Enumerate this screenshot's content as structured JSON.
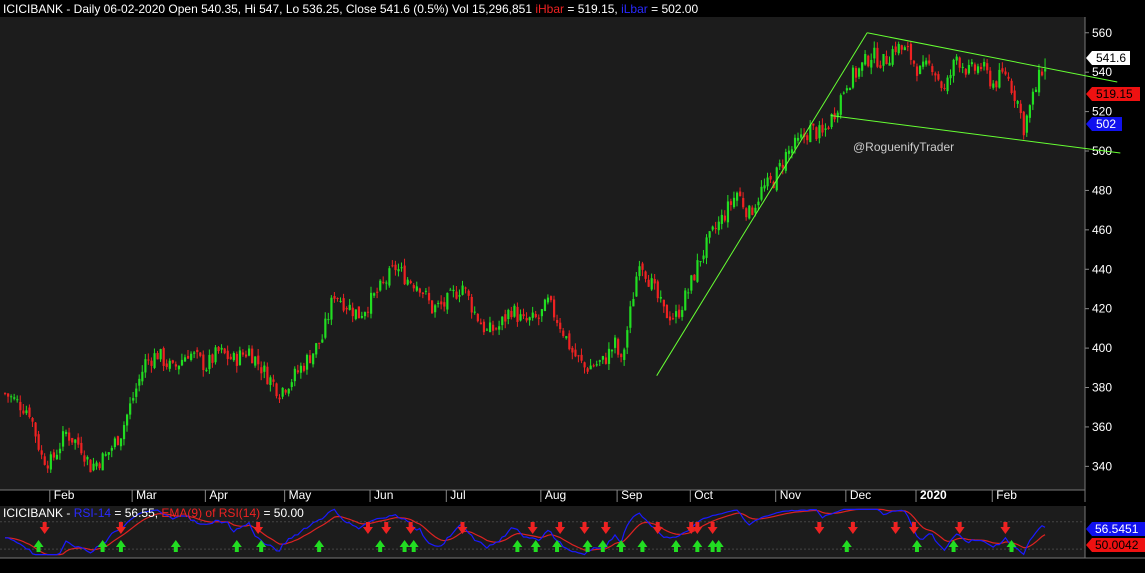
{
  "header": {
    "symbol": "ICICIBANK",
    "info": " - Daily 06-02-2020 Open 540.35, Hi 547, Lo 536.25, Close 541.6 (0.5%) Vol 15,296,851 ",
    "ihbar_label": "iHbar",
    "ihbar_value": " = 519.15, ",
    "ilbar_label": "iLbar",
    "ilbar_value": " = 502.00"
  },
  "watermark": "@RoguenifyTrader",
  "price_badges": {
    "close": "541.6",
    "ihbar": "519.15",
    "ilbar": "502"
  },
  "rsi_header": {
    "symbol": "ICICIBANK",
    "rsi_label": "RSI-14",
    "rsi_value": " = 56.55, ",
    "ema_label": "EMA(9) of RSI(14)",
    "ema_value": " = 50.00"
  },
  "rsi_badges": {
    "rsi": "56.5451",
    "ema": "50.0042"
  },
  "colors": {
    "background": "#000000",
    "plot_bg": "#1c1c1c",
    "up": "#22dd22",
    "down": "#ee2222",
    "channel": "#66ff33",
    "rsi": "#1a1aff",
    "ema": "#dd2222",
    "axis_text": "#ffffff",
    "badge_close": "#ffffff",
    "badge_ihbar": "#ee1111",
    "badge_ilbar": "#1111ee"
  },
  "chart_data": {
    "type": "candlestick",
    "y_ticks": [
      340,
      360,
      380,
      400,
      420,
      440,
      460,
      480,
      500,
      520,
      540,
      560
    ],
    "ylim": [
      328,
      568
    ],
    "x_labels": [
      "Feb",
      "Mar",
      "Apr",
      "May",
      "Jun",
      "Jul",
      "Aug",
      "Sep",
      "Oct",
      "Nov",
      "Dec",
      "2020",
      "Feb"
    ],
    "anchor_closes": [
      [
        0,
        377
      ],
      [
        8,
        368
      ],
      [
        12,
        345
      ],
      [
        15,
        342
      ],
      [
        20,
        357
      ],
      [
        25,
        350
      ],
      [
        28,
        340
      ],
      [
        33,
        345
      ],
      [
        38,
        357
      ],
      [
        42,
        375
      ],
      [
        46,
        393
      ],
      [
        50,
        397
      ],
      [
        55,
        389
      ],
      [
        60,
        398
      ],
      [
        66,
        391
      ],
      [
        70,
        398
      ],
      [
        75,
        394
      ],
      [
        80,
        399
      ],
      [
        85,
        388
      ],
      [
        90,
        378
      ],
      [
        95,
        386
      ],
      [
        100,
        396
      ],
      [
        104,
        405
      ],
      [
        108,
        428
      ],
      [
        112,
        422
      ],
      [
        116,
        417
      ],
      [
        120,
        424
      ],
      [
        124,
        432
      ],
      [
        128,
        441
      ],
      [
        132,
        435
      ],
      [
        136,
        432
      ],
      [
        140,
        420
      ],
      [
        144,
        422
      ],
      [
        150,
        432
      ],
      [
        154,
        418
      ],
      [
        158,
        408
      ],
      [
        162,
        411
      ],
      [
        166,
        420
      ],
      [
        170,
        413
      ],
      [
        175,
        415
      ],
      [
        178,
        423
      ],
      [
        182,
        412
      ],
      [
        186,
        398
      ],
      [
        190,
        390
      ],
      [
        196,
        393
      ],
      [
        200,
        402
      ],
      [
        202,
        392
      ],
      [
        205,
        418
      ],
      [
        208,
        446
      ],
      [
        212,
        432
      ],
      [
        216,
        418
      ],
      [
        220,
        416
      ],
      [
        224,
        429
      ],
      [
        228,
        446
      ],
      [
        232,
        458
      ],
      [
        236,
        468
      ],
      [
        240,
        479
      ],
      [
        244,
        468
      ],
      [
        248,
        480
      ],
      [
        252,
        485
      ],
      [
        256,
        498
      ],
      [
        260,
        504
      ],
      [
        264,
        511
      ],
      [
        268,
        508
      ],
      [
        272,
        520
      ],
      [
        276,
        535
      ],
      [
        280,
        541
      ],
      [
        284,
        549
      ],
      [
        288,
        545
      ],
      [
        292,
        553
      ],
      [
        296,
        550
      ],
      [
        300,
        540
      ],
      [
        304,
        544
      ],
      [
        308,
        530
      ],
      [
        312,
        548
      ],
      [
        316,
        540
      ],
      [
        320,
        543
      ],
      [
        324,
        534
      ],
      [
        328,
        540
      ],
      [
        332,
        525
      ],
      [
        334,
        512
      ],
      [
        337,
        527
      ],
      [
        340,
        541.6
      ]
    ],
    "channels": [
      {
        "name": "",
        "start": [
          214,
          386
        ],
        "end": [
          283,
          560
        ]
      },
      {
        "name": "",
        "start": [
          283,
          560
        ],
        "end": [
          365,
          535
        ]
      },
      {
        "name": "",
        "start": [
          271,
          518
        ],
        "end": [
          366,
          499
        ]
      }
    ],
    "rsi_series": {
      "name": "RSI-14",
      "last": 56.55
    },
    "ema_series": {
      "name": "EMA(9) of RSI(14)",
      "last": 50.0
    },
    "buy_signals": [
      11,
      32,
      38,
      56,
      76,
      84,
      103,
      123,
      131,
      134,
      168,
      174,
      181,
      191,
      196,
      202,
      209,
      220,
      227,
      232,
      234,
      276,
      299,
      311,
      330
    ],
    "sell_signals": [
      13,
      38,
      83,
      119,
      125,
      133,
      150,
      173,
      182,
      190,
      197,
      214,
      225,
      227,
      232,
      267,
      278,
      292,
      298,
      313,
      328
    ]
  }
}
